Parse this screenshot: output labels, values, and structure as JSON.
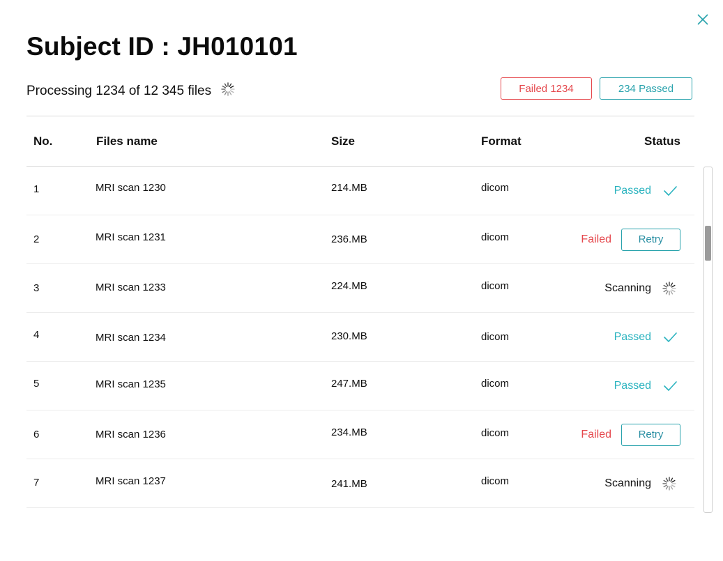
{
  "dialog": {
    "title": "Subject ID : JH010101",
    "progress_text": "Processing 1234 of 12 345 files",
    "badges": {
      "failed": "Failed 1234",
      "passed": "234 Passed"
    }
  },
  "table": {
    "headers": {
      "no": "No.",
      "name": "Files name",
      "size": "Size",
      "format": "Format",
      "status": "Status"
    },
    "rows": [
      {
        "no": "1",
        "name": "MRI scan 1230",
        "size": "214.MB",
        "format": "dicom",
        "status": "Passed"
      },
      {
        "no": "2",
        "name": "MRI scan 1231",
        "size": "236.MB",
        "format": "dicom",
        "status": "Failed",
        "action": "Retry"
      },
      {
        "no": "3",
        "name": "MRI scan 1233",
        "size": "224.MB",
        "format": "dicom",
        "status": "Scanning"
      },
      {
        "no": "4",
        "name": "MRI scan 1234",
        "size": "230.MB",
        "format": "dicom",
        "status": "Passed"
      },
      {
        "no": "5",
        "name": "MRI scan 1235",
        "size": "247.MB",
        "format": "dicom",
        "status": "Passed"
      },
      {
        "no": "6",
        "name": "MRI scan 1236",
        "size": "234.MB",
        "format": "dicom",
        "status": "Failed",
        "action": "Retry"
      },
      {
        "no": "7",
        "name": "MRI scan 1237",
        "size": "241.MB",
        "format": "dicom",
        "status": "Scanning"
      }
    ]
  },
  "icons": {
    "close": "close-icon",
    "spinner": "spinner-icon",
    "check": "check-icon"
  },
  "colors": {
    "accent": "#2aa3ad",
    "passed": "#2ab3bf",
    "failed": "#e5484d"
  }
}
